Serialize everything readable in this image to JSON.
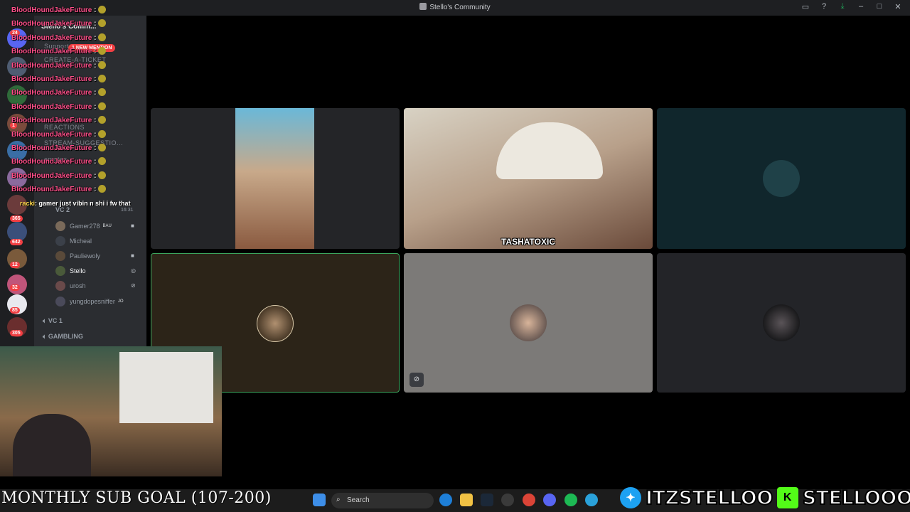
{
  "window": {
    "title": "Stello's Community"
  },
  "titlebar_icons": [
    "inbox-icon",
    "help-icon",
    "download-icon",
    "minimize-icon",
    "maximize-icon",
    "close-icon"
  ],
  "server": {
    "name": "Stello's Comm...",
    "mention_pill": "1 NEW MENTION"
  },
  "server_badges": [
    "24",
    "1",
    "365",
    "642",
    "12",
    "32",
    "85",
    "305"
  ],
  "channels": [
    {
      "name": "Support"
    },
    {
      "name": "CREATE-A-TICKET"
    },
    {
      "name": "REACTIONS"
    },
    {
      "name": "STREAM-SUGGESTIO..."
    },
    {
      "name": "emotes"
    }
  ],
  "voice": {
    "active_channel": "VC 2",
    "elapsed": "16:31",
    "members": [
      {
        "name": "Gamer278",
        "tag": "BAU"
      },
      {
        "name": "Micheal",
        "tag": ""
      },
      {
        "name": "Pauliewoly",
        "tag": ""
      },
      {
        "name": "Stello",
        "tag": ""
      },
      {
        "name": "urosh",
        "tag": ""
      },
      {
        "name": "yungdopesniffer",
        "tag": "JO"
      }
    ],
    "other_channels": [
      "VC 1",
      "GAMBLING"
    ]
  },
  "chat": {
    "repeat_user": "BloodHoundJakeFuture",
    "separator": ":",
    "repeat_count": 14,
    "last_user": "racki",
    "last_message": "gamer just vibin n shi i fw that"
  },
  "video_tiles": [
    {
      "label": ""
    },
    {
      "label": "TASHATOXIC"
    },
    {
      "label": ""
    },
    {
      "label": ""
    },
    {
      "label": ""
    },
    {
      "label": ""
    }
  ],
  "overlay": {
    "sub_goal": "MONTHLY SUB GOAL (107-200)",
    "twitter_handle": "ITZSTELLOO",
    "kick_handle": "STELLOOO",
    "kick_letter": "K"
  },
  "taskbar": {
    "search_placeholder": "Search"
  },
  "colors": {
    "chat_name": "#ff4f8a",
    "speaking_ring": "#3ba55d",
    "kick_green": "#53fc18",
    "twitter_blue": "#1da1f2"
  }
}
